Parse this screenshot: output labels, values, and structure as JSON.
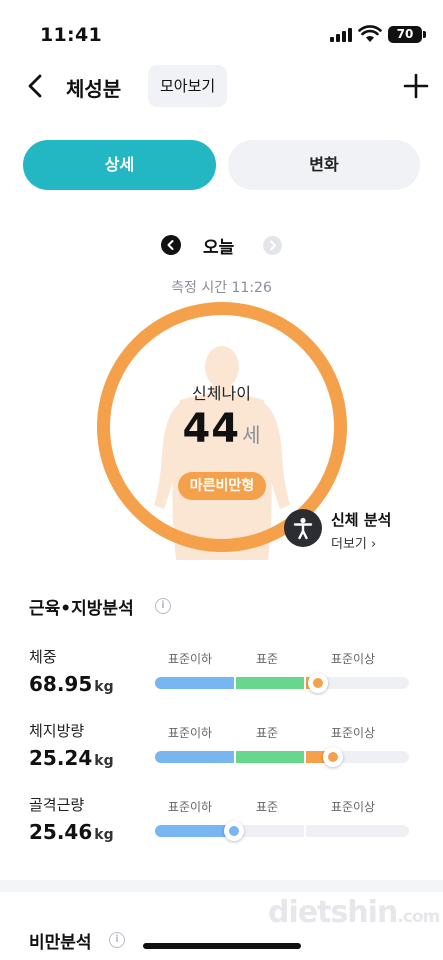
{
  "status_bar": {
    "time": "11:41",
    "battery": "70"
  },
  "header": {
    "title": "체성분",
    "collect_label": "모아보기"
  },
  "tabs": [
    {
      "label": "상세",
      "active": true
    },
    {
      "label": "변화",
      "active": false
    }
  ],
  "date_nav": {
    "label": "오늘",
    "measure_time": "측정 시간 11:26"
  },
  "body_age": {
    "label": "신체나이",
    "value": "44",
    "unit": "세",
    "type_badge": "마른비만형",
    "analysis_title": "신체 분석",
    "analysis_more": "더보기 ›"
  },
  "muscle_fat": {
    "title": "근육•지방분석",
    "range_labels": [
      "표준이하",
      "표준",
      "표준이상"
    ],
    "metrics": [
      {
        "name": "체중",
        "value": "68.95",
        "unit": "kg",
        "level_percent": 64,
        "zone": "standard"
      },
      {
        "name": "체지방량",
        "value": "25.24",
        "unit": "kg",
        "level_percent": 70,
        "zone": "above"
      },
      {
        "name": "골격근량",
        "value": "25.46",
        "unit": "kg",
        "level_percent": 31,
        "zone": "below"
      }
    ]
  },
  "obesity": {
    "title": "비만분석"
  },
  "watermark": {
    "main": "dietshin",
    "suffix": ".com"
  },
  "colors": {
    "accent": "#23b7c3",
    "ring": "#f5a04a",
    "below": "#77b6f0",
    "standard": "#68d68c",
    "above": "#f5a04a"
  }
}
